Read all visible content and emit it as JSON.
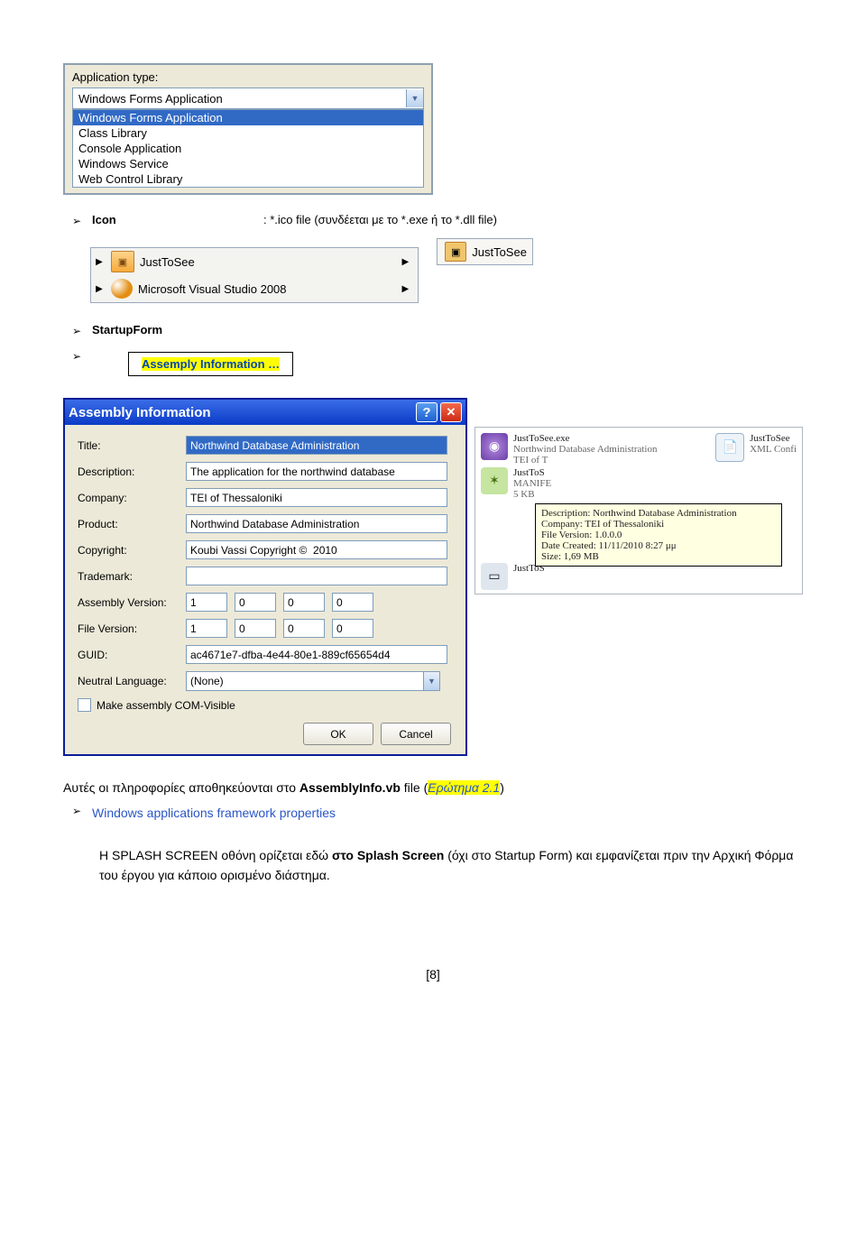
{
  "dropdown": {
    "label": "Application type:",
    "selected": "Windows Forms Application",
    "options": [
      "Windows Forms Application",
      "Class Library",
      "Console Application",
      "Windows Service",
      "Web Control Library"
    ]
  },
  "icon_bullet": {
    "key": "Icon",
    "value": ": *.ico file (συνδέεται με το *.exe ή το  *.dll file)"
  },
  "menu": {
    "items": [
      "JustToSee",
      "Microsoft Visual Studio 2008"
    ],
    "right": "JustToSee"
  },
  "startup": {
    "label": "StartupForm"
  },
  "asm_btn": {
    "label": "Assemply Information …"
  },
  "dialog": {
    "title": "Assembly Information",
    "fields": {
      "title_l": "Title:",
      "title_v": "Northwind Database Administration",
      "desc_l": "Description:",
      "desc_v": "The application for the northwind database",
      "comp_l": "Company:",
      "comp_v": "TEI of Thessaloniki",
      "prod_l": "Product:",
      "prod_v": "Northwind Database Administration",
      "copy_l": "Copyright:",
      "copy_v": "Koubi Vassi Copyright ©  2010",
      "tm_l": "Trademark:",
      "tm_v": "",
      "av_l": "Assembly Version:",
      "av": [
        "1",
        "0",
        "0",
        "0"
      ],
      "fv_l": "File Version:",
      "fv": [
        "1",
        "0",
        "0",
        "0"
      ],
      "guid_l": "GUID:",
      "guid_v": "ac4671e7-dfba-4e44-80e1-889cf65654d4",
      "nl_l": "Neutral Language:",
      "nl_v": "(None)",
      "com_l": "Make assembly COM-Visible"
    },
    "ok": "OK",
    "cancel": "Cancel"
  },
  "explorer": {
    "row1": {
      "name": "JustToSee.exe",
      "sub": "Northwind Database Administration",
      "sub2": "TEI of T"
    },
    "row_r": {
      "name": "JustToSee",
      "sub": "XML Confi"
    },
    "row2": {
      "name": "JustToS",
      "sub": "MANIFE",
      "sub2": "5 KB"
    },
    "row3": {
      "name": "JustToS"
    },
    "tip": {
      "desc": "Description: Northwind Database Administration",
      "company": "Company: TEI of Thessaloniki",
      "fver": "File Version: 1.0.0.0",
      "date": "Date Created: 11/11/2010 8:27 μμ",
      "size": "Size: 1,69 MB"
    }
  },
  "para1": {
    "pre": "Αυτές οι πληροφορίες αποθηκεύονται στο ",
    "bold": "AssemblyInfo.vb",
    "mid": " file  (",
    "ital": "Ερώτημα 2.1",
    "post": ")"
  },
  "bullet2": "Windows applications framework properties",
  "para2": {
    "t1": "Η SPLASH SCREEN οθόνη ορίζεται εδώ ",
    "b1": "στο Splash Screen",
    "t2": " (όχι στο Startup Form) και εμφανίζεται πριν την Αρχική Φόρμα του έργου για κάποιο ορισμένο διάστημα."
  },
  "page_num": "[8]"
}
